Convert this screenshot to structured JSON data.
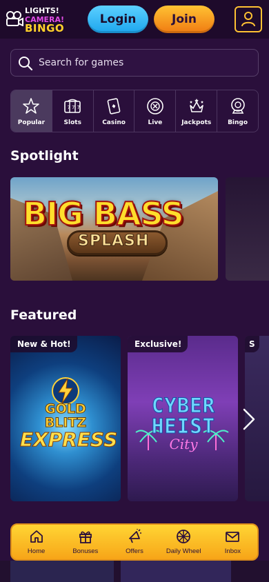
{
  "header": {
    "logo": {
      "line1": "LIGHTS!",
      "line2": "CAMERA!",
      "line3": "BINGO"
    },
    "login_label": "Login",
    "join_label": "Join",
    "account_icon": "user-icon"
  },
  "search": {
    "placeholder": "Search for games",
    "icon": "search-icon"
  },
  "categories": [
    {
      "label": "Popular",
      "icon": "star-icon",
      "active": true
    },
    {
      "label": "Slots",
      "icon": "slot-reels-icon",
      "active": false
    },
    {
      "label": "Casino",
      "icon": "playing-cards-icon",
      "active": false
    },
    {
      "label": "Live",
      "icon": "roulette-chip-icon",
      "active": false
    },
    {
      "label": "Jackpots",
      "icon": "crown-icon",
      "active": false
    },
    {
      "label": "Bingo",
      "icon": "bingo-ball-icon",
      "active": false
    }
  ],
  "spotlight": {
    "title": "Spotlight",
    "cards": [
      {
        "title": "BIG BASS",
        "subtitle": "SPLASH"
      }
    ]
  },
  "featured": {
    "title": "Featured",
    "cards": [
      {
        "badge": "New & Hot!",
        "line1": "GOLD",
        "line2": "BLITZ",
        "line3": "EXPRESS"
      },
      {
        "badge": "Exclusive!",
        "line1": "CYBER",
        "line2": "HEIST",
        "line3": "City"
      },
      {
        "badge": "S"
      }
    ]
  },
  "bottom_nav": [
    {
      "label": "Home",
      "icon": "home-icon"
    },
    {
      "label": "Bonuses",
      "icon": "gift-icon"
    },
    {
      "label": "Offers",
      "icon": "megaphone-icon"
    },
    {
      "label": "Daily Wheel",
      "icon": "wheel-icon"
    },
    {
      "label": "Inbox",
      "icon": "envelope-icon"
    }
  ],
  "colors": {
    "background": "#2a0f3b",
    "header": "#1e0a2b",
    "login": "#1da6ee",
    "join": "#f07b12",
    "accent": "#ffc233"
  }
}
